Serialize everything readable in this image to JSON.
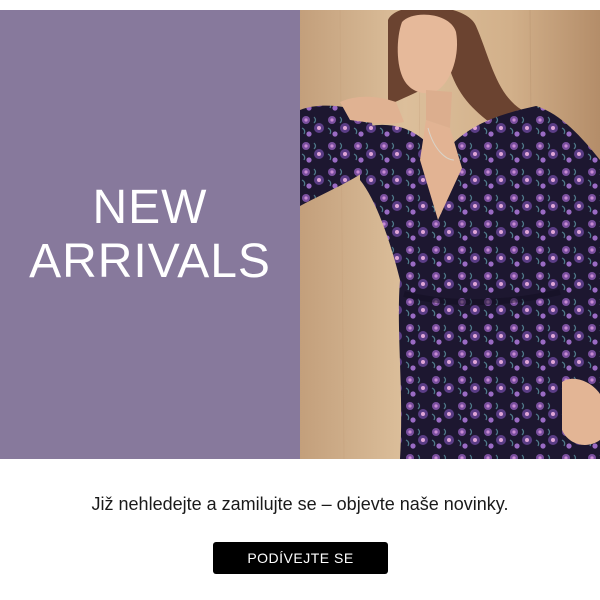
{
  "hero": {
    "headline_line1": "NEW",
    "headline_line2": "ARRIVALS",
    "panel_color": "#87799c",
    "photo_subject": "model-in-floral-dress"
  },
  "body": {
    "tagline": "Již nehledejte a zamilujte se – objevte naše novinky."
  },
  "cta": {
    "label": "PODÍVEJTE SE"
  }
}
